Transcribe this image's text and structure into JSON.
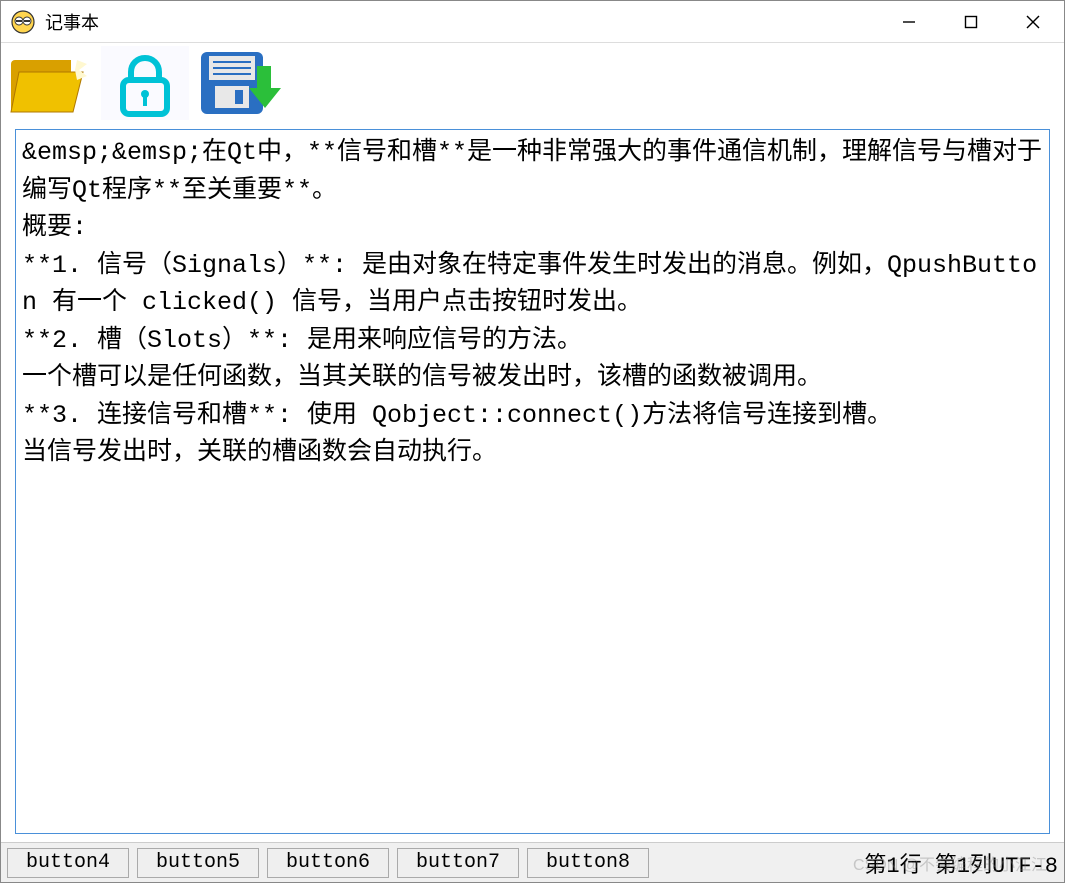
{
  "window": {
    "title": "记事本"
  },
  "toolbar": {
    "open_name": "open-folder-icon",
    "lock_name": "lock-icon",
    "save_name": "save-download-icon"
  },
  "editor": {
    "content": "&emsp;&emsp;在Qt中，**信号和槽**是一种非常强大的事件通信机制，理解信号与槽对于编写Qt程序**至关重要**。\n概要:\n**1. 信号（Signals）**: 是由对象在特定事件发生时发出的消息。例如，QpushButton 有一个 clicked() 信号，当用户点击按钮时发出。\n**2. 槽（Slots）**: 是用来响应信号的方法。\n一个槽可以是任何函数，当其关联的信号被发出时，该槽的函数被调用。\n**3. 连接信号和槽**: 使用 Qobject::connect()方法将信号连接到槽。\n当信号发出时，关联的槽函数会自动执行。"
  },
  "statusbar": {
    "buttons": [
      "button4",
      "button5",
      "button6",
      "button7",
      "button8"
    ],
    "position": "第1行 第1列UTF-8"
  },
  "watermark": "CSDN @不会编程的小江江"
}
